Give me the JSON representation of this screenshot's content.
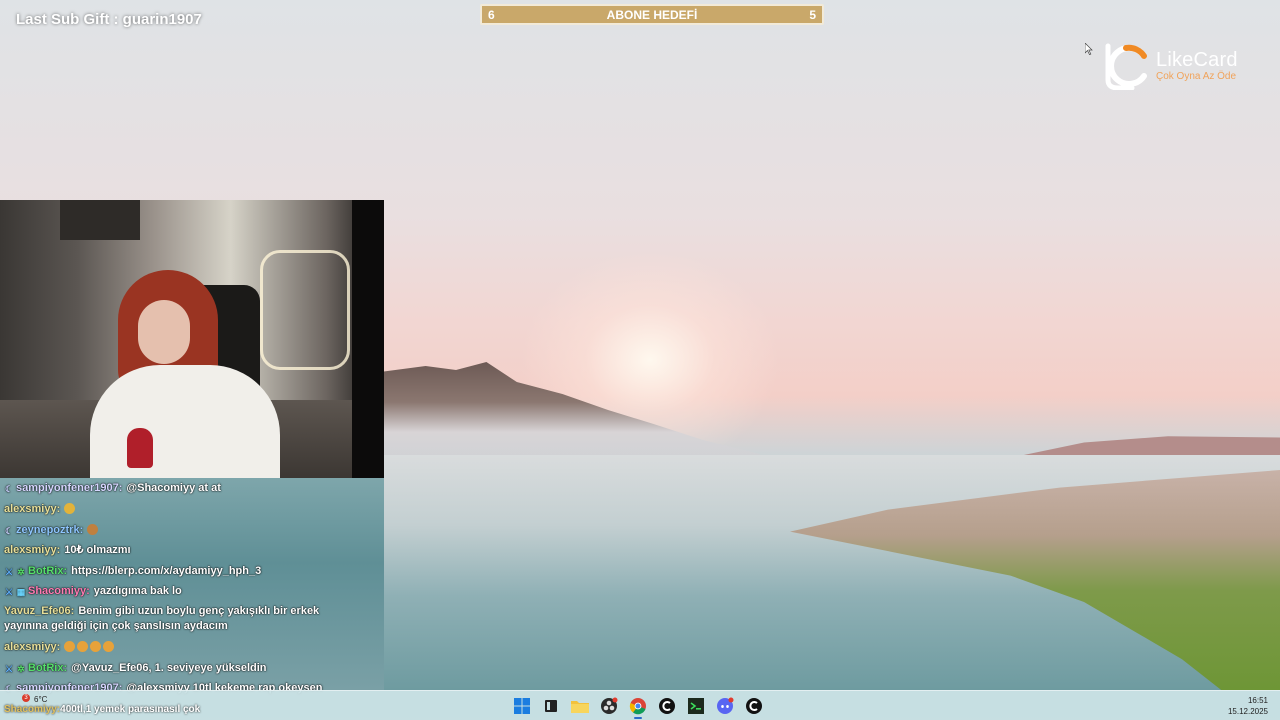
{
  "overlay": {
    "last_sub_gift": "Last Sub Gift : guarin1907",
    "goal": {
      "current": "6",
      "title": "ABONE HEDEFİ",
      "target": "5"
    },
    "sponsor": {
      "brand": "LikeCard",
      "slogan": "Çok Oyna Az Öde"
    }
  },
  "chat": {
    "messages": [
      {
        "user": "sampiyonfener1907:",
        "text": "@Shacomiyy at at",
        "user_color": "#d6d6ff",
        "badges": [
          "moon"
        ]
      },
      {
        "user": "alexsmiyy:",
        "text": "",
        "user_color": "#e8e09a",
        "badges": [],
        "emotes": [
          "hand"
        ]
      },
      {
        "user": "zeynepoztrk:",
        "text": "",
        "user_color": "#8ec6ff",
        "badges": [
          "moon"
        ],
        "emotes": [
          "monkey"
        ]
      },
      {
        "user": "alexsmiyy:",
        "text": "10₺ olmazmı",
        "user_color": "#e8e09a",
        "badges": []
      },
      {
        "user": "BotRix:",
        "text": "https://blerp.com/x/aydamiyy_hph_3",
        "user_color": "#56e06b",
        "badges": [
          "sword",
          "gear"
        ]
      },
      {
        "user": "Shacomiyy:",
        "text": "yazdıgıma bak lo",
        "user_color": "#ff7bb2",
        "badges": [
          "sword",
          "grid"
        ]
      },
      {
        "user": "Yavuz_Efe06:",
        "text": "Benim gibi uzun boylu genç yakışıklı bir erkek yayınına geldiği için çok şanslısın aydacım",
        "user_color": "#e8e09a",
        "badges": []
      },
      {
        "user": "alexsmiyy:",
        "text": "",
        "user_color": "#e8e09a",
        "badges": [],
        "emotes": [
          "angry",
          "angry",
          "angry",
          "angry"
        ]
      },
      {
        "user": "BotRix:",
        "text": "@Yavuz_Efe06, 1. seviyeye yükseldin",
        "user_color": "#56e06b",
        "badges": [
          "sword",
          "gear"
        ]
      },
      {
        "user": "sampiyonfener1907:",
        "text": "@alexsmiyy 10tl kekeme rap okeysen",
        "user_color": "#d6d6ff",
        "badges": [
          "moon"
        ]
      }
    ]
  },
  "taskbar": {
    "weather": "6°C",
    "weather_alert": "3",
    "ticker_user": "Shacomiyy:",
    "ticker_text": "400tl,1 yemek parasınasıl çok",
    "apps": [
      "windows-start",
      "widgets",
      "file-explorer",
      "obs-studio",
      "chrome",
      "capcut",
      "terminal",
      "discord",
      "capcut-alt"
    ],
    "time": "16:51",
    "date": "15.12.2025"
  },
  "colors": {
    "goal_bar": "#c9a86a",
    "sponsor_accent": "#f0a35a",
    "taskbar": "#c8e1e4"
  }
}
